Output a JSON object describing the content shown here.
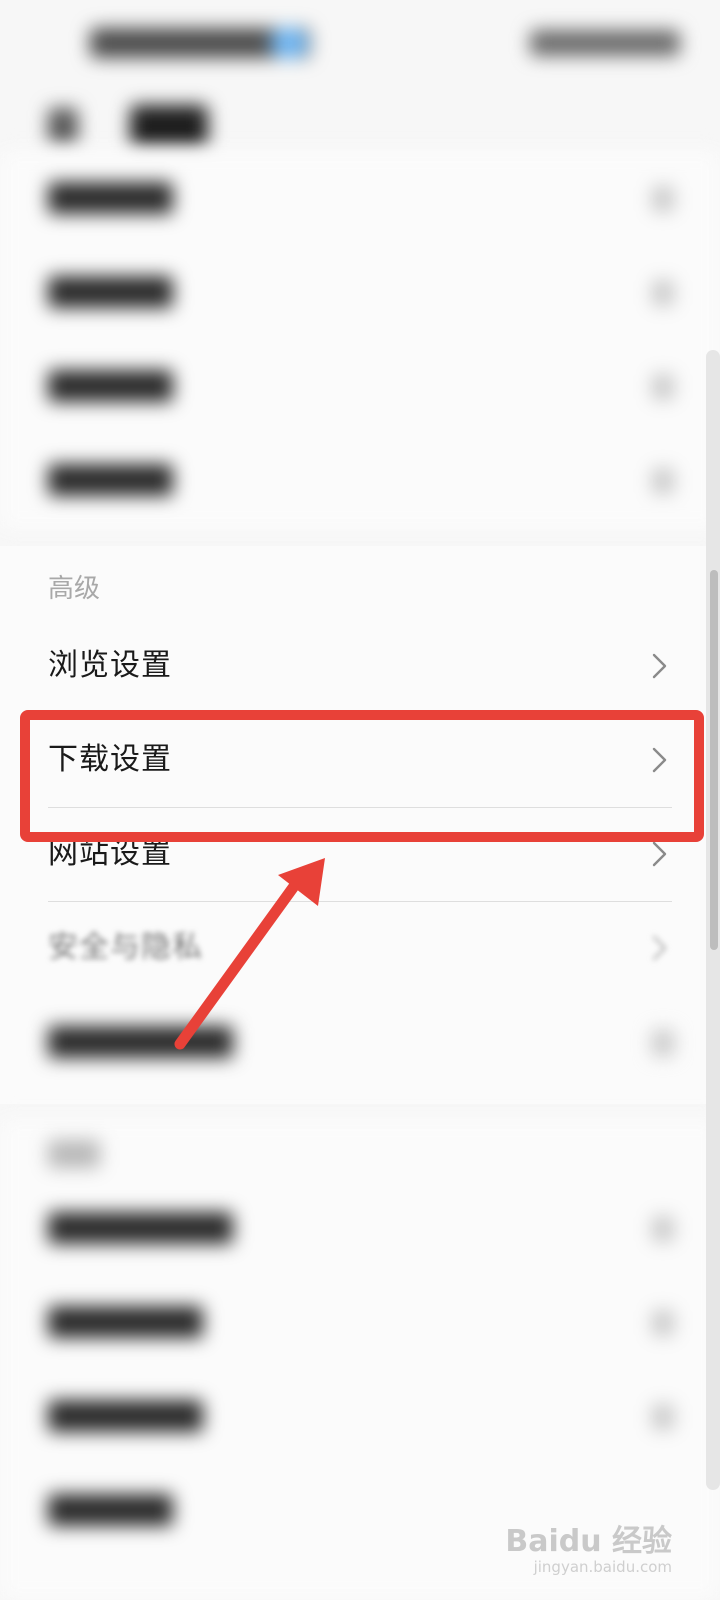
{
  "advanced": {
    "header": "高级",
    "items": [
      {
        "label": "浏览设置"
      },
      {
        "label": "下载设置"
      },
      {
        "label": "网站设置"
      },
      {
        "label": "安全与隐私"
      }
    ]
  },
  "watermark": {
    "brand": "Baidu 经验",
    "url": "jingyan.baidu.com"
  },
  "annotation": {
    "highlight_color": "#e84138",
    "highlighted_item": "下载设置"
  },
  "colors": {
    "background": "#f7f7f7",
    "text": "#1a1a1a",
    "section_header": "#a8a8a8",
    "status_accent": "#6fb6f3"
  }
}
